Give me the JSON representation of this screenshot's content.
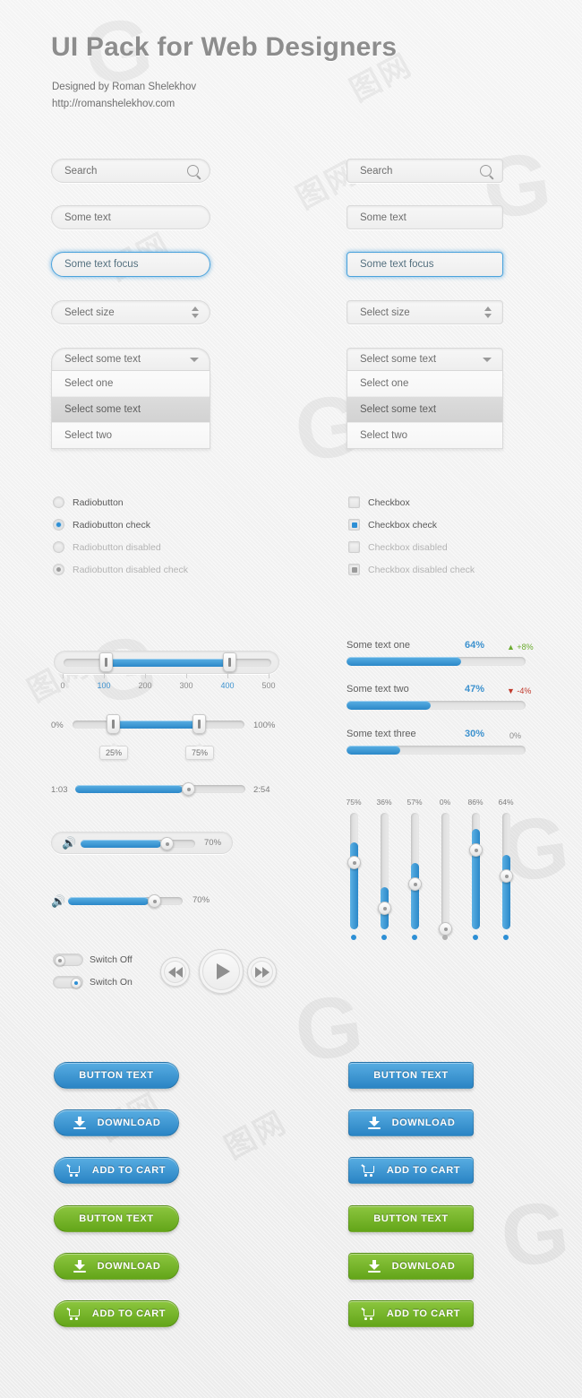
{
  "header": {
    "title": "UI Pack for Web Designers",
    "byline": "Designed by Roman Shelekhov",
    "site": "http://romanshelekhov.com"
  },
  "forms": {
    "search_placeholder": "Search",
    "text_value": "Some text",
    "text_focus_value": "Some text focus",
    "select_size_value": "Select size",
    "dropdown_value": "Select some text",
    "dropdown_options": [
      "Select one",
      "Select some text",
      "Select two"
    ],
    "dropdown_selected_index": 1
  },
  "radios": [
    {
      "label": "Radiobutton",
      "checked": false,
      "disabled": false
    },
    {
      "label": "Radiobutton check",
      "checked": true,
      "disabled": false
    },
    {
      "label": "Radiobutton disabled",
      "checked": false,
      "disabled": true
    },
    {
      "label": "Radiobutton disabled check",
      "checked": true,
      "disabled": true
    }
  ],
  "checkboxes": [
    {
      "label": "Checkbox",
      "checked": false,
      "disabled": false
    },
    {
      "label": "Checkbox check",
      "checked": true,
      "disabled": false
    },
    {
      "label": "Checkbox disabled",
      "checked": false,
      "disabled": true
    },
    {
      "label": "Checkbox disabled check",
      "checked": true,
      "disabled": true
    }
  ],
  "range_slider": {
    "min": 0,
    "max": 500,
    "low": 100,
    "high": 400,
    "ticks": [
      "0",
      "100",
      "200",
      "300",
      "400",
      "500"
    ],
    "highlighted_ticks": [
      1,
      4
    ]
  },
  "percent_slider": {
    "min_label": "0%",
    "max_label": "100%",
    "low_label": "25%",
    "high_label": "75%",
    "low": 25,
    "high": 75
  },
  "time_slider": {
    "current": "1:03",
    "total": "2:54",
    "progress": 60
  },
  "volume_sliders": [
    {
      "value_label": "70%",
      "value": 70
    },
    {
      "value_label": "70%",
      "value": 70
    }
  ],
  "progress_rows": [
    {
      "label": "Some text one",
      "value_label": "64%",
      "value": 64,
      "delta": "+8%",
      "trend": "up"
    },
    {
      "label": "Some text two",
      "value_label": "47%",
      "value": 47,
      "delta": "-4%",
      "trend": "down"
    },
    {
      "label": "Some text three",
      "value_label": "30%",
      "value": 30,
      "delta": "0%",
      "trend": "flat"
    }
  ],
  "vertical_sliders": [
    {
      "label": "75%",
      "value": 75
    },
    {
      "label": "36%",
      "value": 36
    },
    {
      "label": "57%",
      "value": 57
    },
    {
      "label": "0%",
      "value": 0
    },
    {
      "label": "86%",
      "value": 86
    },
    {
      "label": "64%",
      "value": 64
    }
  ],
  "switches": [
    {
      "label": "Switch Off",
      "on": false
    },
    {
      "label": "Switch On",
      "on": true
    }
  ],
  "media": {
    "rewind": "rewind-icon",
    "play": "play-icon",
    "forward": "forward-icon"
  },
  "buttons": {
    "text": "BUTTON TEXT",
    "download": "DOWNLOAD",
    "cart": "ADD TO CART"
  },
  "colors": {
    "blue": "#2b88c8",
    "blue_light": "#5bb0e4",
    "green": "#8cc63f",
    "green_dark": "#63a519",
    "up": "#6aab2e",
    "down": "#c0392b",
    "text": "#6e6e6e"
  },
  "watermarks": {
    "mark_c": "G",
    "mark_box": "图网"
  }
}
